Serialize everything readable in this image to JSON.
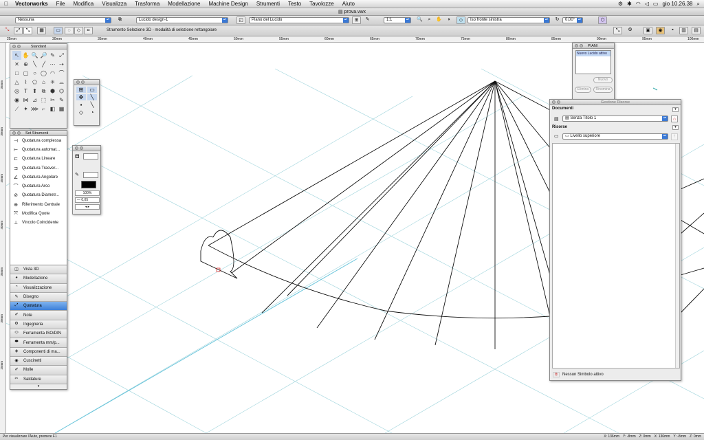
{
  "menubar": {
    "app": "Vectorworks",
    "items": [
      "File",
      "Modifica",
      "Visualizza",
      "Trasforma",
      "Modellazione",
      "Machine Design",
      "Strumenti",
      "Testo",
      "Tavolozze",
      "Aiuto"
    ],
    "clock": "gio 10.26.38"
  },
  "window": {
    "title": "prova.vwx"
  },
  "bar1": {
    "classe": "Nessuna",
    "lucido": "Lucido design-1",
    "piano": "Piano del Lucido",
    "scala": "1:1",
    "vista": "Iso fronte sinistra",
    "angolo": "0,00°"
  },
  "bar2": {
    "tool_message": "Strumento Selezione 3D - modalità di selezione rettangolare"
  },
  "ruler": {
    "labels": [
      "25mm",
      "30mm",
      "35mm",
      "40mm",
      "45mm",
      "50mm",
      "55mm",
      "60mm",
      "65mm",
      "70mm",
      "75mm",
      "80mm",
      "85mm",
      "90mm",
      "95mm",
      "100mm"
    ]
  },
  "vruler": {
    "labels": [
      "35mm",
      "30mm",
      "45mm",
      "40mm",
      "35mm",
      "30mm",
      "25mm"
    ]
  },
  "standard_palette": {
    "title": "Standard",
    "tools": [
      "↖",
      "✋",
      "🔍",
      "🔎",
      "✎",
      "⤢",
      "✕",
      "⊕",
      "╲",
      "╱",
      "⋯",
      "⇢",
      "□",
      "▢",
      "○",
      "◯",
      "◠",
      "⌒",
      "△",
      "⌇",
      "⬠",
      "⌂",
      "✳",
      "⌓",
      "◎",
      "T",
      "⬆",
      "⧉",
      "⬢",
      "⌬",
      "◉",
      "⋈",
      "⊿",
      "⬚",
      "✂",
      "✎",
      "⟋",
      "✦",
      "⋙",
      "⌐",
      "◧",
      "▦"
    ]
  },
  "set_palette": {
    "title": "Set Strumenti",
    "items": [
      {
        "icon": "⊣",
        "label": "Quotatura complessa"
      },
      {
        "icon": "⊢",
        "label": "Quotatura automat..."
      },
      {
        "icon": "⊏",
        "label": "Quotatura Lineare"
      },
      {
        "icon": "⊐",
        "label": "Quotatura Trasver..."
      },
      {
        "icon": "∠",
        "label": "Quotatura Angolare"
      },
      {
        "icon": "⌒",
        "label": "Quotatura Arco"
      },
      {
        "icon": "⊘",
        "label": "Quotatura Diametr..."
      },
      {
        "icon": "⊕",
        "label": "Riferimento Centrale"
      },
      {
        "icon": "⤧",
        "label": "Modifica Quote"
      },
      {
        "icon": "⊥",
        "label": "Vincolo Coincidente"
      }
    ],
    "categories": [
      {
        "icon": "◫",
        "label": "Vista 3D"
      },
      {
        "icon": "◕",
        "label": "Modellazione"
      },
      {
        "icon": "◔",
        "label": "Visualizzazione"
      },
      {
        "icon": "✎",
        "label": "Disegno"
      },
      {
        "icon": "⤢",
        "label": "Quotatura"
      },
      {
        "icon": "✐",
        "label": "Note"
      },
      {
        "icon": "⚙",
        "label": "Ingegneria"
      },
      {
        "icon": "⬭",
        "label": "Ferramenta ISO/DIN"
      },
      {
        "icon": "⬬",
        "label": "Ferramenta mm/p..."
      },
      {
        "icon": "◈",
        "label": "Componenti di ma..."
      },
      {
        "icon": "◉",
        "label": "Cuscinetti"
      },
      {
        "icon": "✐",
        "label": "Molle"
      },
      {
        "icon": "✂",
        "label": "Saldature"
      }
    ],
    "selected": 4
  },
  "attr_palette": {
    "fill_color": "#000000",
    "percent": "100%",
    "line_weight": "0,05"
  },
  "layers_palette": {
    "title": "PIANI",
    "item": "Nuovo Lucido attivo",
    "buttons": [
      "Nuovo",
      "Elimina",
      "Rinomina"
    ]
  },
  "resources": {
    "title": "Gestione Risorse",
    "documents_label": "Documenti",
    "document_value": "Senza Titolo 1",
    "resources_label": "Risorse",
    "resource_value": "Livello superiore",
    "symbol_status": "Nessun Simbolo attivo"
  },
  "status": {
    "message": "Per visualizzare l'Aiuto, premere F1",
    "coords": [
      "X: 136mm",
      "Y: -8mm",
      "Z: 0mm",
      "X: 136mm",
      "Y: -8mm",
      "Z: 0mm"
    ]
  }
}
